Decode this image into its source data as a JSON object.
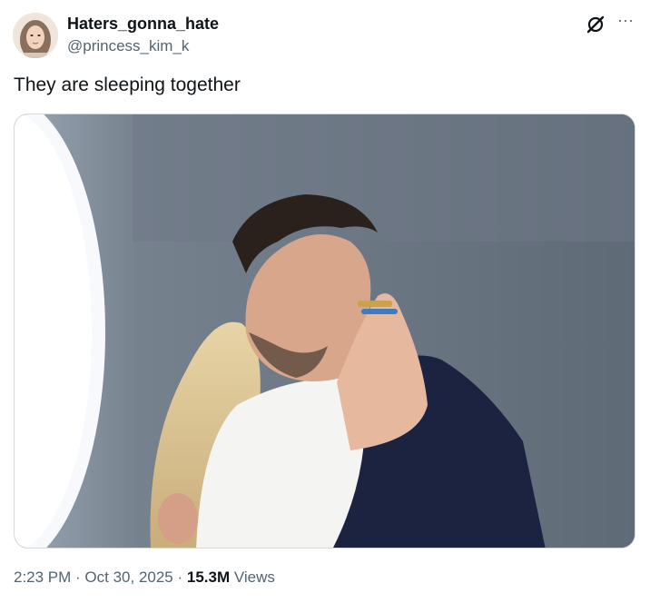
{
  "author": {
    "display_name": "Haters_gonna_hate",
    "handle": "@princess_kim_k",
    "avatar_icon": "profile-avatar"
  },
  "header_actions": {
    "grok_icon": "grok-icon",
    "more_icon": "more-options-icon",
    "more_glyph": "···"
  },
  "post": {
    "text": "They are sleeping together",
    "media_icon": "photo"
  },
  "meta": {
    "time": "2:23 PM",
    "separator1": " · ",
    "date": "Oct 30, 2025",
    "separator2": " · ",
    "views_count": "15.3M",
    "views_label": " Views"
  },
  "colors": {
    "text_primary": "#0f1419",
    "text_secondary": "#536471",
    "border": "#cfd9de"
  }
}
